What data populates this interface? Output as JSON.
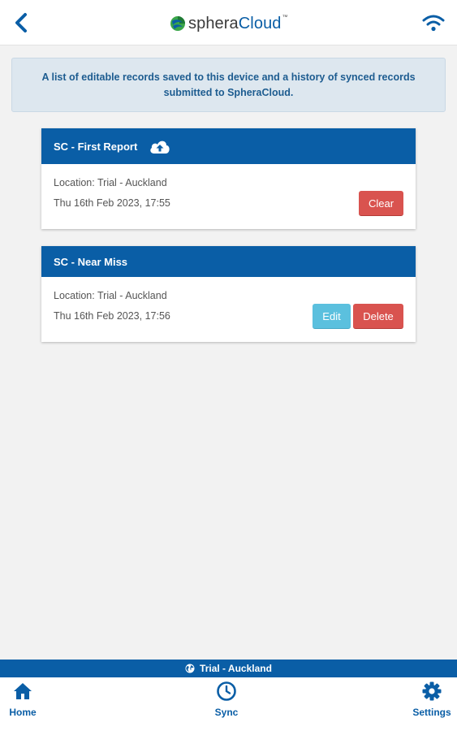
{
  "header": {
    "logo_part1": "sphera",
    "logo_part2": "Cloud",
    "logo_tm": "™",
    "back_icon": "chevron-left-icon",
    "connection_icon": "wifi-icon"
  },
  "banner": {
    "text": "A list of editable records saved to this device and a history of synced records submitted to SpheraCloud."
  },
  "records": [
    {
      "title": "SC - First Report",
      "status_icon": "cloud-upload-icon",
      "location": "Location: Trial - Auckland",
      "date": "Thu 16th Feb 2023, 17:55",
      "clear_label": "Clear"
    },
    {
      "title": "SC - Near Miss",
      "location": "Location: Trial - Auckland",
      "date": "Thu 16th Feb 2023, 17:56",
      "edit_label": "Edit",
      "delete_label": "Delete"
    }
  ],
  "location_strip": {
    "text": "Trial - Auckland",
    "icon": "globe-icon"
  },
  "nav": {
    "home_label": "Home",
    "sync_label": "Sync",
    "settings_label": "Settings"
  },
  "colors": {
    "brand_blue": "#0a5ea6",
    "danger": "#d9534f",
    "info": "#5bc0de",
    "banner_bg": "#dde7ef"
  }
}
